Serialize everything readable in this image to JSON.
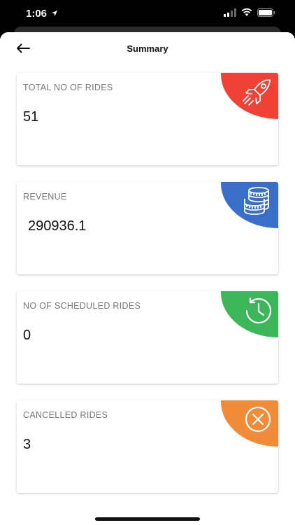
{
  "status_bar": {
    "time": "1:06"
  },
  "header": {
    "title": "Summary"
  },
  "cards": [
    {
      "label": "TOTAL NO OF RIDES",
      "value": "51",
      "color": "#f04137",
      "icon": "rocket-icon"
    },
    {
      "label": "REVENUE",
      "value": "290936.1",
      "color": "#3a6fc9",
      "icon": "coins-icon"
    },
    {
      "label": "NO OF SCHEDULED RIDES",
      "value": "0",
      "color": "#3db559",
      "icon": "clock-history-icon"
    },
    {
      "label": "CANCELLED RIDES",
      "value": "3",
      "color": "#f08b3a",
      "icon": "cancel-circle-icon"
    }
  ]
}
